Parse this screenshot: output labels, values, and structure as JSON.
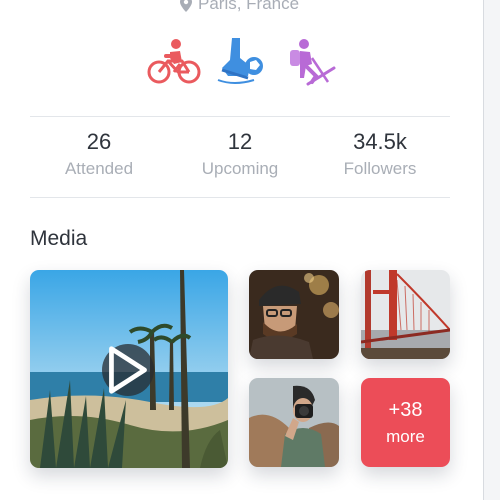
{
  "profile": {
    "location": "Paris, France"
  },
  "activities": [
    {
      "icon": "cycling-icon",
      "color": "#ea5a5e"
    },
    {
      "icon": "soccer-icon",
      "color": "#3f8fe0"
    },
    {
      "icon": "hiking-icon",
      "color": "#b86ad6"
    }
  ],
  "stats": [
    {
      "value": "26",
      "label": "Attended"
    },
    {
      "value": "12",
      "label": "Upcoming"
    },
    {
      "value": "34.5k",
      "label": "Followers"
    }
  ],
  "media": {
    "title": "Media",
    "more": {
      "count": "+38",
      "label": "more"
    }
  },
  "colors": {
    "accent_red": "#ec4d58",
    "muted_text": "#a9aeb6"
  }
}
